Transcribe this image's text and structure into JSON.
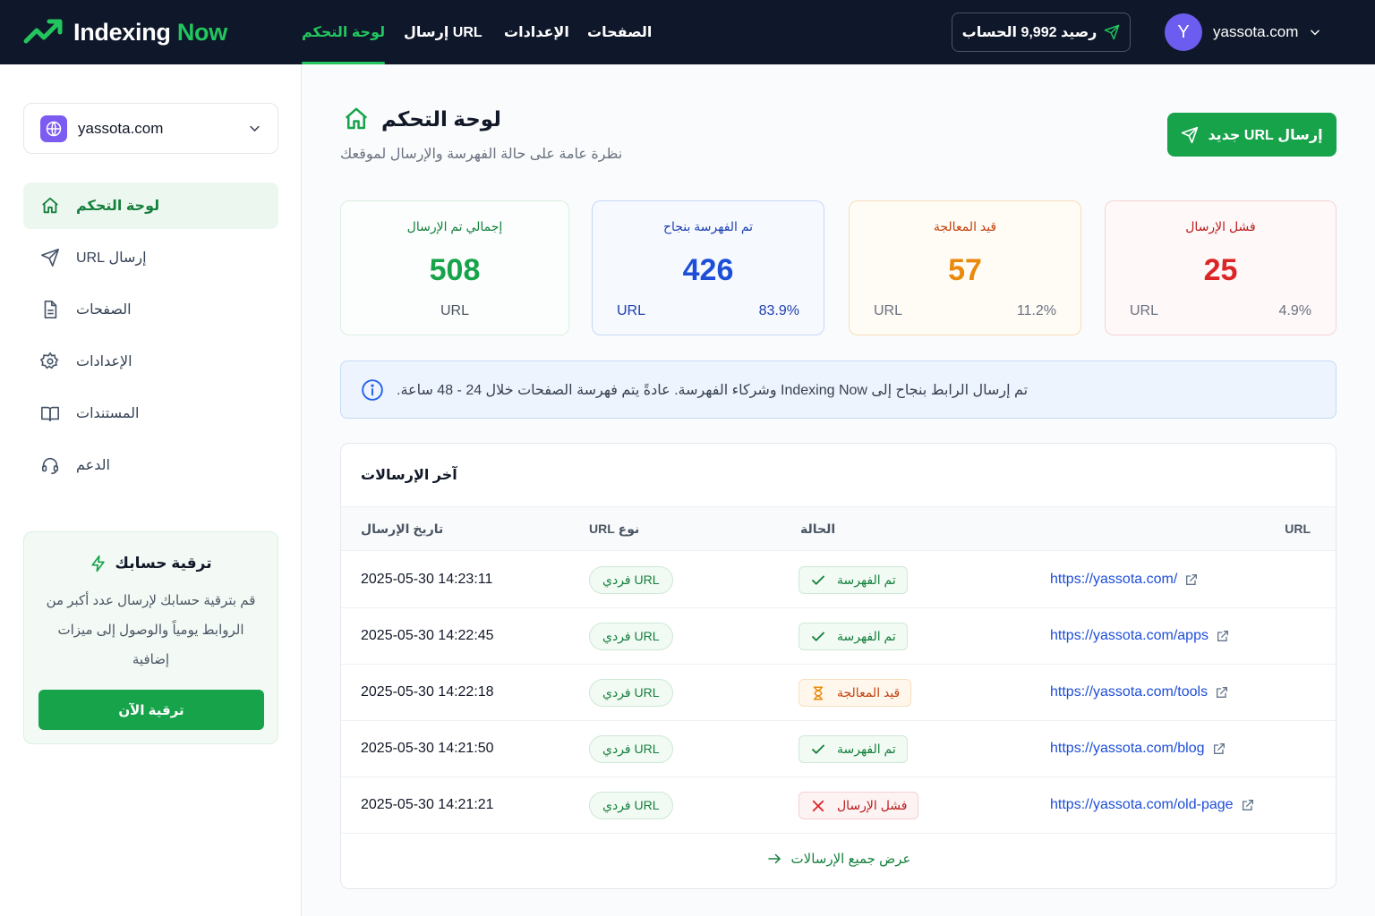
{
  "app": {
    "name_main": "Indexing",
    "name_accent": "Now"
  },
  "nav": {
    "dashboard": "لوحة التحكم",
    "submit_url": "إرسال URL",
    "settings": "الإعدادات",
    "pages": "الصفحات"
  },
  "balance": {
    "label": "رصيد 9,992 الحساب"
  },
  "user": {
    "initial": "Y",
    "site": "yassota.com"
  },
  "sidebar": {
    "site": "yassota.com",
    "items": [
      {
        "label": "لوحة التحكم",
        "icon": "home-icon"
      },
      {
        "label": "إرسال URL",
        "icon": "send-icon"
      },
      {
        "label": "الصفحات",
        "icon": "document-icon"
      },
      {
        "label": "الإعدادات",
        "icon": "gear-icon"
      },
      {
        "label": "المستندات",
        "icon": "book-icon"
      },
      {
        "label": "الدعم",
        "icon": "headset-icon"
      }
    ],
    "upgrade": {
      "title": "ترقية حسابك",
      "text": "قم بترقية حسابك لإرسال عدد أكبر من الروابط يومياً والوصول إلى ميزات إضافية",
      "button": "ترقية الآن"
    }
  },
  "main": {
    "title": "لوحة التحكم",
    "subtitle": "نظرة عامة على حالة الفهرسة والإرسال لموقعك",
    "new_button": "إرسال URL جديد"
  },
  "stats": [
    {
      "title": "إجمالي تم الإرسال",
      "value": "508",
      "unit": "URL",
      "percent": "",
      "color": "#16a34a"
    },
    {
      "title": "تم الفهرسة بنجاح",
      "value": "426",
      "unit": "URL",
      "percent": "83.9%",
      "color": "#1d4ed8"
    },
    {
      "title": "قيد المعالجة",
      "value": "57",
      "unit": "URL",
      "percent": "11.2%",
      "color": "#ea8a0c"
    },
    {
      "title": "فشل الإرسال",
      "value": "25",
      "unit": "URL",
      "percent": "4.9%",
      "color": "#dc2626"
    }
  ],
  "info": {
    "text": "تم إرسال الرابط بنجاح إلى Indexing Now وشركاء الفهرسة. عادةً يتم فهرسة الصفحات خلال 24 - 48 ساعة."
  },
  "submissions": {
    "title": "آخر الإرسالات",
    "headers": {
      "date": "تاريخ الإرسال",
      "type": "نوع URL",
      "status": "الحالة",
      "url": "URL"
    },
    "rows": [
      {
        "date": "2025-05-30 14:23:11",
        "type": "URL فردي",
        "status": "تم الفهرسة",
        "status_kind": "indexed",
        "url": "https://yassota.com/"
      },
      {
        "date": "2025-05-30 14:22:45",
        "type": "URL فردي",
        "status": "تم الفهرسة",
        "status_kind": "indexed",
        "url": "https://yassota.com/apps"
      },
      {
        "date": "2025-05-30 14:22:18",
        "type": "URL فردي",
        "status": "قيد المعالجة",
        "status_kind": "pending",
        "url": "https://yassota.com/tools"
      },
      {
        "date": "2025-05-30 14:21:50",
        "type": "URL فردي",
        "status": "تم الفهرسة",
        "status_kind": "indexed",
        "url": "https://yassota.com/blog"
      },
      {
        "date": "2025-05-30 14:21:21",
        "type": "URL فردي",
        "status": "فشل الإرسال",
        "status_kind": "failed",
        "url": "https://yassota.com/old-page"
      }
    ],
    "view_all": "عرض جميع الإرسالات"
  }
}
